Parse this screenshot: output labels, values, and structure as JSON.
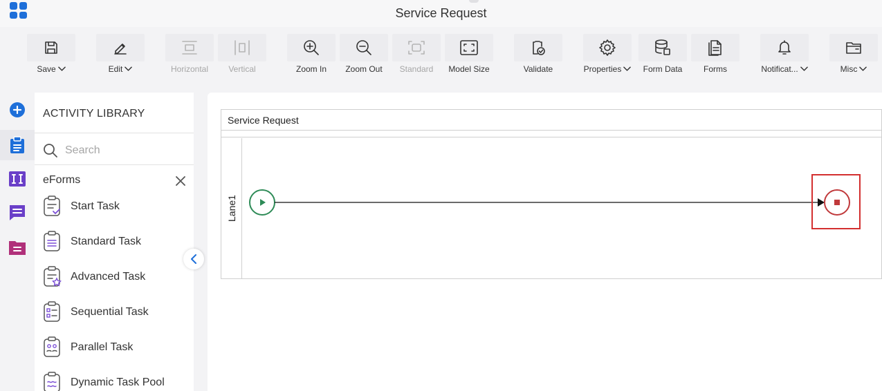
{
  "app": {
    "title": "Service Request"
  },
  "toolbar": {
    "save": "Save",
    "edit": "Edit",
    "horizontal": "Horizontal",
    "vertical": "Vertical",
    "zoom_in": "Zoom In",
    "zoom_out": "Zoom Out",
    "standard": "Standard",
    "model_size": "Model Size",
    "validate": "Validate",
    "properties": "Properties",
    "form_data": "Form Data",
    "forms": "Forms",
    "notifications": "Notificat...",
    "misc": "Misc"
  },
  "library": {
    "title": "ACTIVITY LIBRARY",
    "search_placeholder": "Search",
    "section": "eForms",
    "items": [
      {
        "label": "Start Task"
      },
      {
        "label": "Standard Task"
      },
      {
        "label": "Advanced Task"
      },
      {
        "label": "Sequential Task"
      },
      {
        "label": "Parallel Task"
      },
      {
        "label": "Dynamic Task Pool"
      }
    ]
  },
  "canvas": {
    "pool_title": "Service Request",
    "lane_label": "Lane1"
  },
  "colors": {
    "accent": "#1e6fd9",
    "start_event": "#2e8b57",
    "end_event": "#c0393b",
    "highlight": "#d32f2f",
    "task_icon": "#7b4fd6"
  },
  "icons": {
    "rail": [
      "add-circle-icon",
      "clipboard-icon",
      "integration-icon",
      "chat-icon",
      "forms-folder-icon"
    ]
  }
}
